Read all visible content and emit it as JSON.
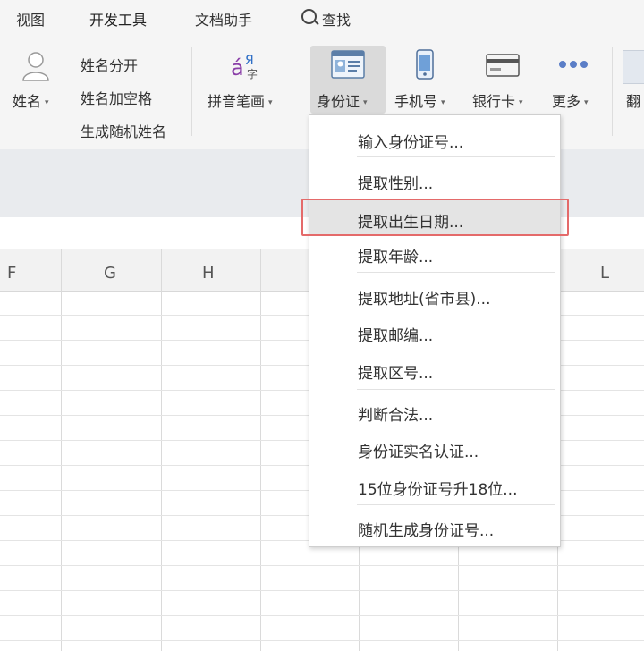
{
  "menubar": {
    "view": "视图",
    "dev_tools": "开发工具",
    "doc_assistant": "文档助手",
    "search": "查找"
  },
  "ribbon": {
    "name_button": "姓名",
    "name_split": "姓名分开",
    "name_add_space": "姓名加空格",
    "random_name": "生成随机姓名",
    "pinyin": "拼音笔画",
    "id_card": "身份证",
    "phone": "手机号",
    "bank_card": "银行卡",
    "more": "更多",
    "translate_partial": "翻",
    "caret": "▾"
  },
  "columns": [
    "F",
    "G",
    "H",
    "L"
  ],
  "dropdown": {
    "items": [
      "输入身份证号...",
      "提取性别...",
      "提取出生日期...",
      "提取年龄...",
      "提取地址(省市县)...",
      "提取邮编...",
      "提取区号...",
      "判断合法...",
      "身份证实名认证...",
      "15位身份证号升18位...",
      "随机生成身份证号..."
    ]
  },
  "colors": {
    "highlight_border": "#e46a6a",
    "hover_bg": "#e4e4e4",
    "ribbon_bg": "#f5f5f5"
  }
}
